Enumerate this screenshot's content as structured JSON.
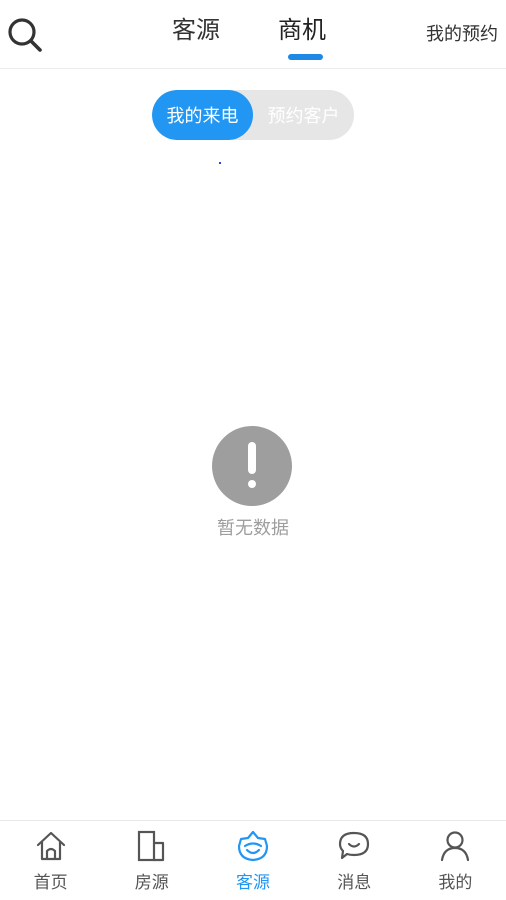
{
  "header": {
    "tabs": [
      {
        "label": "客源",
        "active": false
      },
      {
        "label": "商机",
        "active": true
      }
    ],
    "right_link": "我的预约"
  },
  "segment": {
    "options": [
      {
        "label": "我的来电",
        "active": true
      },
      {
        "label": "预约客户",
        "active": false
      }
    ]
  },
  "empty_state": {
    "text": "暂无数据"
  },
  "bottom_nav": {
    "items": [
      {
        "label": "首页",
        "icon": "home-icon",
        "active": false
      },
      {
        "label": "房源",
        "icon": "building-icon",
        "active": false
      },
      {
        "label": "客源",
        "icon": "customer-icon",
        "active": true
      },
      {
        "label": "消息",
        "icon": "message-icon",
        "active": false
      },
      {
        "label": "我的",
        "icon": "user-icon",
        "active": false
      }
    ]
  },
  "colors": {
    "accent": "#2196f3",
    "tab_underline": "#1e88e5",
    "empty_icon": "#9e9e9e"
  }
}
